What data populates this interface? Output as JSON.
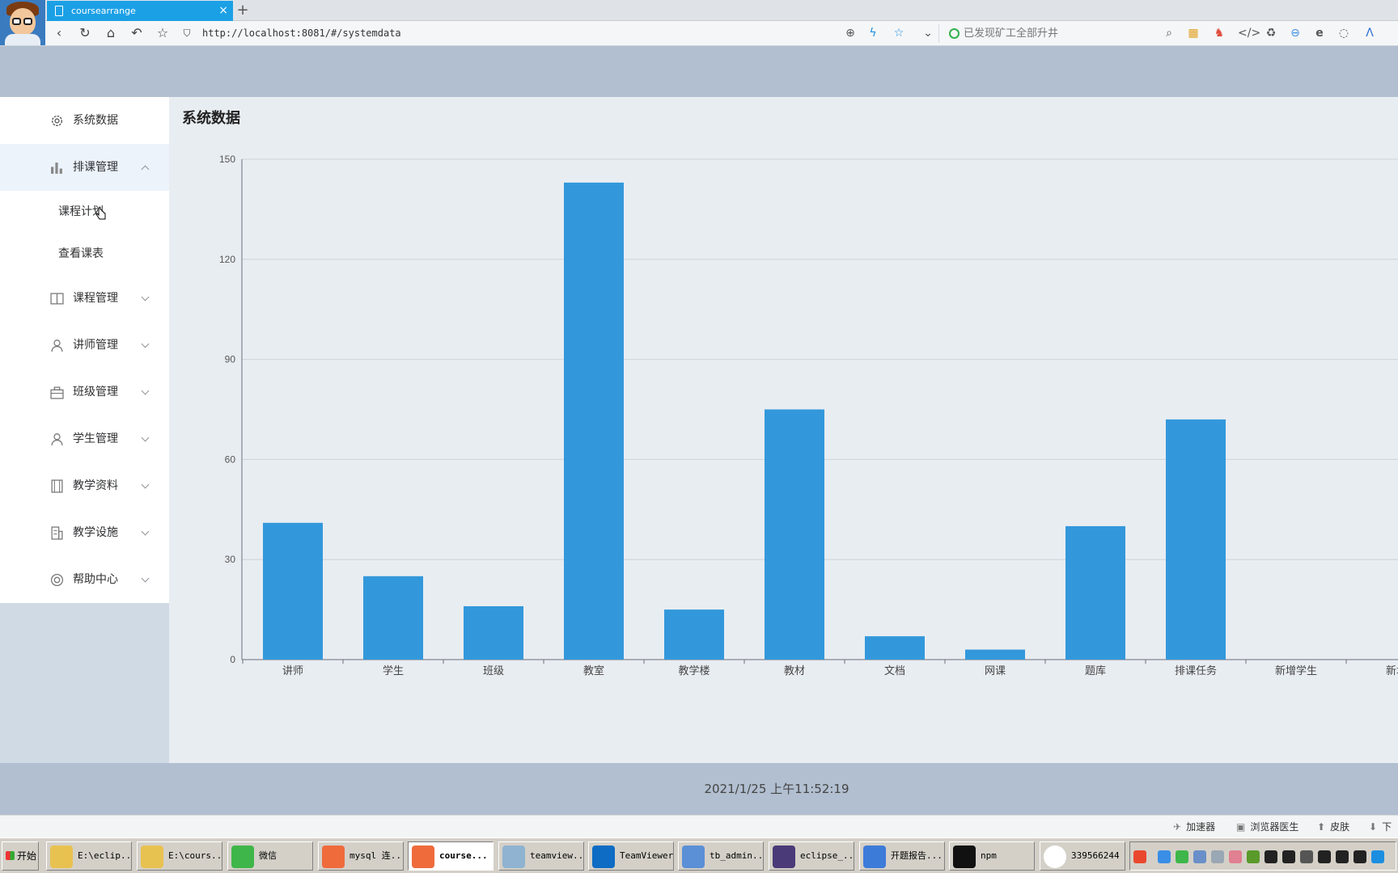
{
  "browser": {
    "tab_title": "coursearrange",
    "tab_close": "×",
    "new_tab": "+",
    "url": "http://localhost:8081/#/systemdata",
    "search_placeholder": "已发现矿工全部升井"
  },
  "sidebar": {
    "items": [
      {
        "label": "系统数据",
        "icon": "gear-icon"
      },
      {
        "label": "排课管理",
        "icon": "bar-chart-icon",
        "open": true,
        "children": [
          {
            "label": "课程计划"
          },
          {
            "label": "查看课表"
          }
        ]
      },
      {
        "label": "课程管理",
        "icon": "book-icon"
      },
      {
        "label": "讲师管理",
        "icon": "user-icon"
      },
      {
        "label": "班级管理",
        "icon": "box-icon"
      },
      {
        "label": "学生管理",
        "icon": "user-icon"
      },
      {
        "label": "教学资料",
        "icon": "film-icon"
      },
      {
        "label": "教学设施",
        "icon": "building-icon"
      },
      {
        "label": "帮助中心",
        "icon": "help-icon"
      }
    ]
  },
  "main": {
    "title": "系统数据"
  },
  "chart_data": {
    "type": "bar",
    "categories": [
      "讲师",
      "学生",
      "班级",
      "教室",
      "教学楼",
      "教材",
      "文档",
      "网课",
      "题库",
      "排课任务",
      "新增学生",
      "新增"
    ],
    "values": [
      41,
      25,
      16,
      143,
      15,
      75,
      7,
      3,
      40,
      72,
      0,
      0
    ],
    "yticks": [
      0,
      30,
      60,
      90,
      120,
      150
    ],
    "ylim": [
      0,
      150
    ],
    "bar_color": "#3398db",
    "grid": true
  },
  "footer": {
    "datetime": "2021/1/25 上午11:52:19"
  },
  "statusbar": {
    "items": [
      "加速器",
      "浏览器医生",
      "皮肤",
      "下"
    ]
  },
  "taskbar": {
    "start": "开始",
    "buttons": [
      {
        "label": "E:\\eclip...",
        "color": "#e8c250"
      },
      {
        "label": "E:\\cours...",
        "color": "#e8c250"
      },
      {
        "label": "微信",
        "color": "#3fb649"
      },
      {
        "label": "mysql 连...",
        "color": "#ef6b3c"
      },
      {
        "label": "course...",
        "color": "#ef6b3c",
        "active": true
      },
      {
        "label": "teamview...",
        "color": "#8fb3d0"
      },
      {
        "label": "TeamViewer",
        "color": "#0e6cc4"
      },
      {
        "label": "tb_admin...",
        "color": "#5b8fd6"
      },
      {
        "label": "eclipse_...",
        "color": "#4b3a78"
      },
      {
        "label": "开题报告...",
        "color": "#3d7bd9"
      },
      {
        "label": "npm",
        "color": "#111111"
      },
      {
        "label": "339566244",
        "color": "#ffffff"
      }
    ]
  }
}
